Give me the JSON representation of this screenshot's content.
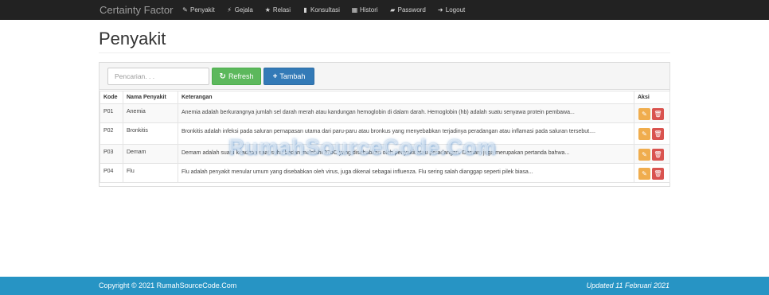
{
  "navbar": {
    "brand": "Certainty Factor",
    "items": [
      {
        "label": "Penyakit",
        "icon": "wrench-icon",
        "glyph": "✎"
      },
      {
        "label": "Gejala",
        "icon": "flash-icon",
        "glyph": "⚡"
      },
      {
        "label": "Relasi",
        "icon": "star-icon",
        "glyph": "★"
      },
      {
        "label": "Konsultasi",
        "icon": "stats-icon",
        "glyph": "▮"
      },
      {
        "label": "Histori",
        "icon": "calendar-icon",
        "glyph": "▦"
      },
      {
        "label": "Password",
        "icon": "lock-icon",
        "glyph": "▰"
      },
      {
        "label": "Logout",
        "icon": "logout-icon",
        "glyph": "➜"
      }
    ]
  },
  "page": {
    "title": "Penyakit"
  },
  "toolbar": {
    "search_placeholder": "Pencarian. . .",
    "refresh_label": "Refresh",
    "refresh_icon": "↻",
    "add_label": "Tambah",
    "add_icon": "+"
  },
  "table": {
    "headers": {
      "code": "Kode",
      "name": "Nama Penyakit",
      "desc": "Keterangan",
      "action": "Aksi"
    },
    "rows": [
      {
        "code": "P01",
        "name": "Anemia",
        "desc": "Anemia adalah berkurangnya jumlah sel darah merah atau kandungan hemoglobin di dalam darah. Hemoglobin (hb) adalah suatu senyawa protein pembawa..."
      },
      {
        "code": "P02",
        "name": "Bronkitis",
        "desc": "Bronkitis adalah infeksi pada saluran pernapasan utama dari paru-paru atau bronkus yang menyebabkan terjadinya peradangan atau inflamasi pada saluran tersebut...."
      },
      {
        "code": "P03",
        "name": "Demam",
        "desc": "Demam adalah suatu keadaan saat suhu badan melebihi 37oC yang disebabkan oleh penyakit atau peradangan. Demam juga merupakan pertanda bahwa..."
      },
      {
        "code": "P04",
        "name": "Flu",
        "desc": "Flu adalah penyakit menular umum yang disebabkan oleh virus, juga dikenal sebagai influenza. Flu sering salah dianggap seperti pilek biasa..."
      }
    ],
    "edit_icon": "✎",
    "delete_icon": "🗑"
  },
  "watermark": "RumahSourceCode.Com",
  "footer": {
    "copyright": "Copyright © 2021 RumahSourceCode.Com",
    "updated": "Updated 11 Februari 2021"
  },
  "colors": {
    "navbar": "#222222",
    "refresh": "#5cb85c",
    "add": "#337ab7",
    "edit": "#f0ad4e",
    "delete": "#d9534f",
    "footer": "#2794c4"
  }
}
